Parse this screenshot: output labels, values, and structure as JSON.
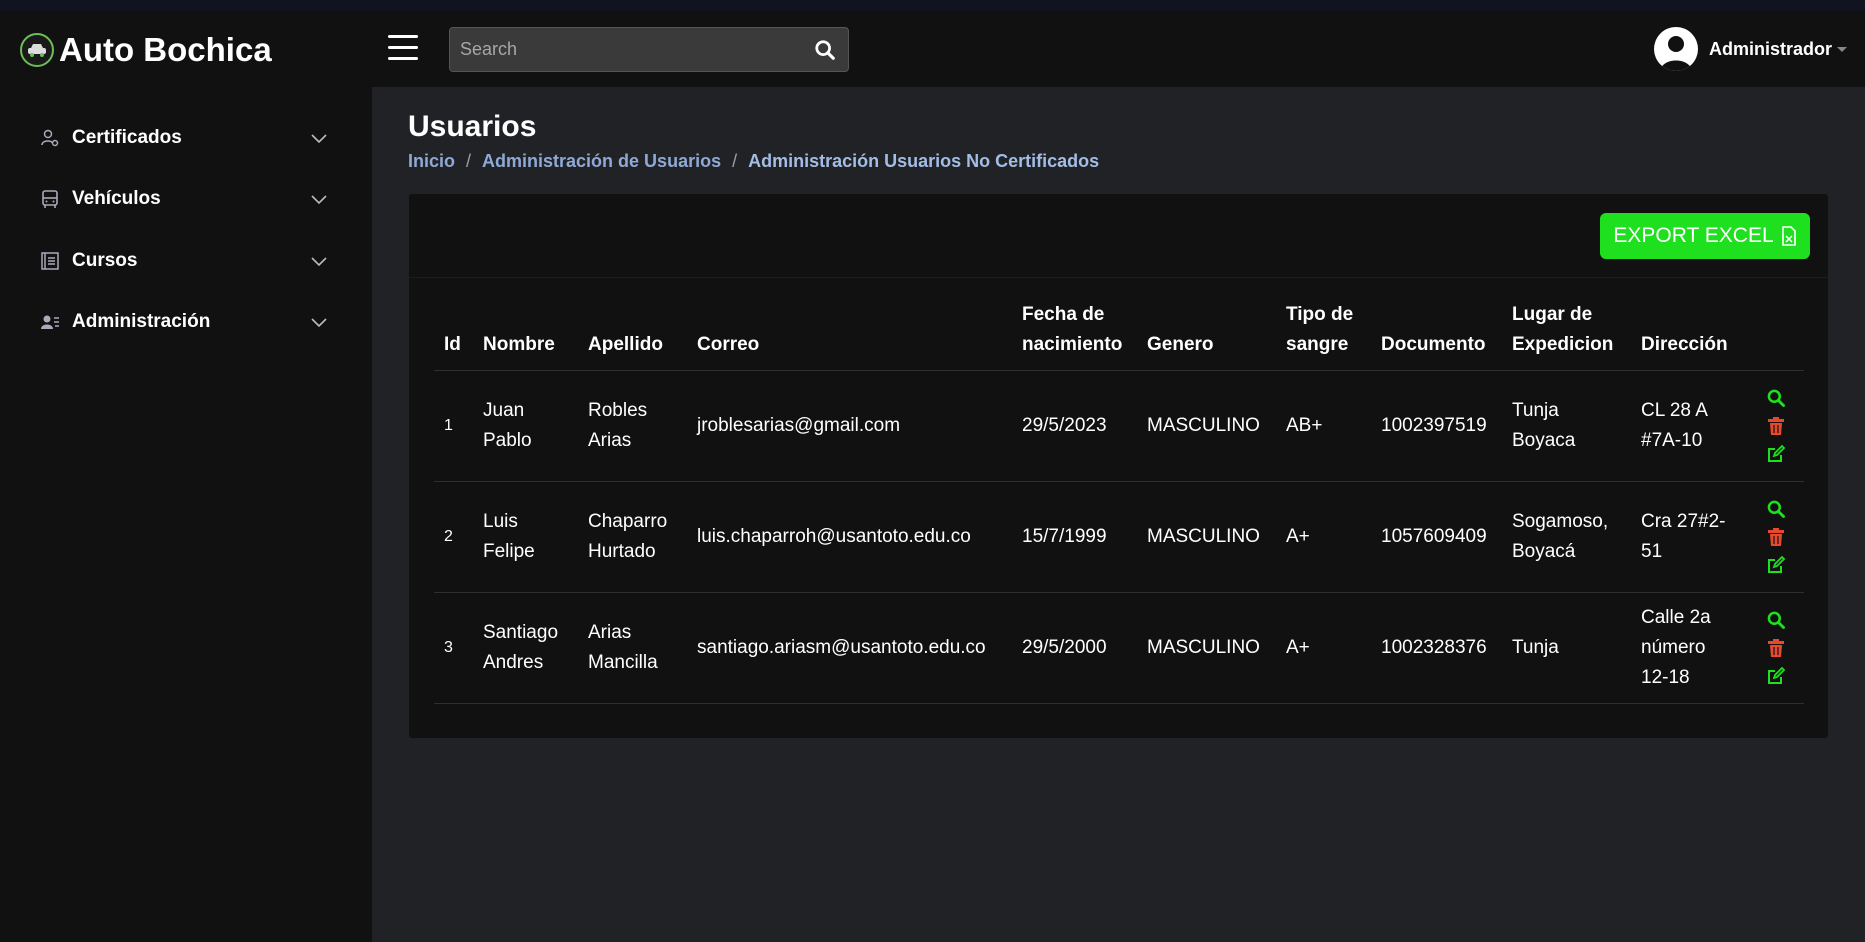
{
  "header": {
    "app_title": "Auto Bochica",
    "search_placeholder": "Search",
    "user_name": "Administrador"
  },
  "sidebar": {
    "items": [
      {
        "label": "Certificados",
        "icon": "user-cert-icon"
      },
      {
        "label": "Vehículos",
        "icon": "bus-icon"
      },
      {
        "label": "Cursos",
        "icon": "list-icon"
      },
      {
        "label": "Administración",
        "icon": "user-admin-icon"
      }
    ]
  },
  "page": {
    "title": "Usuarios",
    "breadcrumb": [
      "Inicio",
      "Administración de Usuarios",
      "Administración Usuarios No Certificados"
    ]
  },
  "toolbar": {
    "export_label": "EXPORT EXCEL"
  },
  "table": {
    "headers": {
      "id": "Id",
      "nombre": "Nombre",
      "apellido": "Apellido",
      "correo": "Correo",
      "fecha_1": "Fecha de",
      "fecha_2": "nacimiento",
      "genero": "Genero",
      "tipo_1": "Tipo de",
      "tipo_2": "sangre",
      "documento": "Documento",
      "lugar_1": "Lugar de",
      "lugar_2": "Expedicion",
      "direccion": "Dirección"
    },
    "rows": [
      {
        "id": "1",
        "nombre_1": "Juan",
        "nombre_2": "Pablo",
        "apellido_1": "Robles",
        "apellido_2": "Arias",
        "correo": "jroblesarias@gmail.com",
        "fecha": "29/5/2023",
        "genero": "MASCULINO",
        "sangre": "AB+",
        "documento": "1002397519",
        "lugar_1": "Tunja",
        "lugar_2": "Boyaca",
        "dir_1": "CL 28 A",
        "dir_2": "#7A-10",
        "dir_3": ""
      },
      {
        "id": "2",
        "nombre_1": "Luis",
        "nombre_2": "Felipe",
        "apellido_1": "Chaparro",
        "apellido_2": "Hurtado",
        "correo": "luis.chaparroh@usantoto.edu.co",
        "fecha": "15/7/1999",
        "genero": "MASCULINO",
        "sangre": "A+",
        "documento": "1057609409",
        "lugar_1": "Sogamoso,",
        "lugar_2": "Boyacá",
        "dir_1": "Cra 27#2-",
        "dir_2": "51",
        "dir_3": ""
      },
      {
        "id": "3",
        "nombre_1": "Santiago",
        "nombre_2": "Andres",
        "apellido_1": "Arias",
        "apellido_2": "Mancilla",
        "correo": "santiago.ariasm@usantoto.edu.co",
        "fecha": "29/5/2000",
        "genero": "MASCULINO",
        "sangre": "A+",
        "documento": "1002328376",
        "lugar_1": "Tunja",
        "lugar_2": "",
        "dir_1": "Calle 2a",
        "dir_2": "número",
        "dir_3": "12-18"
      }
    ]
  },
  "colors": {
    "accent_green": "#1ee01e",
    "delete_red": "#e8492e",
    "breadcrumb_link": "#8fa9d6"
  }
}
